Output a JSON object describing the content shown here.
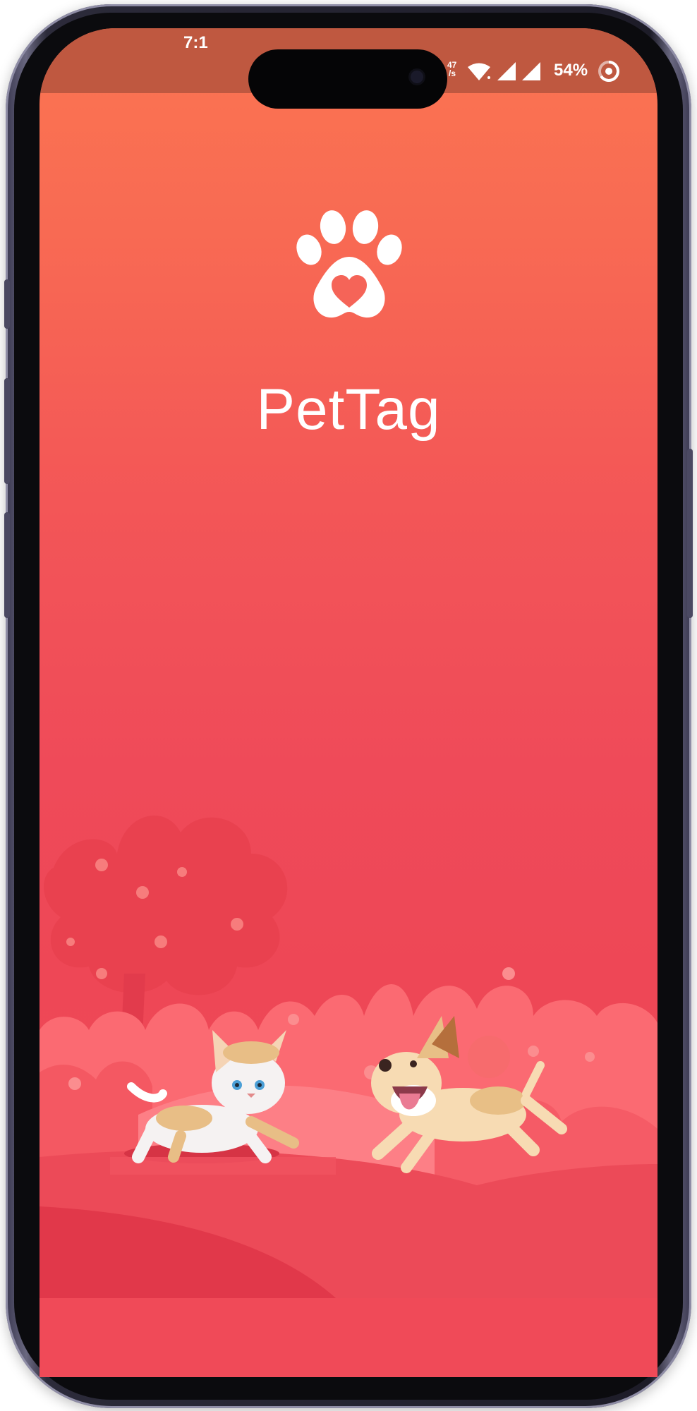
{
  "status_bar": {
    "time": "7:1",
    "network_speed_top": "47",
    "network_speed_unit": "/s",
    "battery_percent": "54%",
    "icons": [
      "wifi-icon",
      "cell-signal-icon",
      "cell-signal-icon",
      "battery-ring-icon"
    ]
  },
  "splash": {
    "app_name": "PetTag",
    "logo_icon": "paw-heart-icon",
    "illustration": "cat-and-dog-running-illustration"
  },
  "colors": {
    "gradient_top": "#fb7552",
    "gradient_bottom": "#ef4a59",
    "status_bar": "#bf5840",
    "text": "#ffffff"
  }
}
